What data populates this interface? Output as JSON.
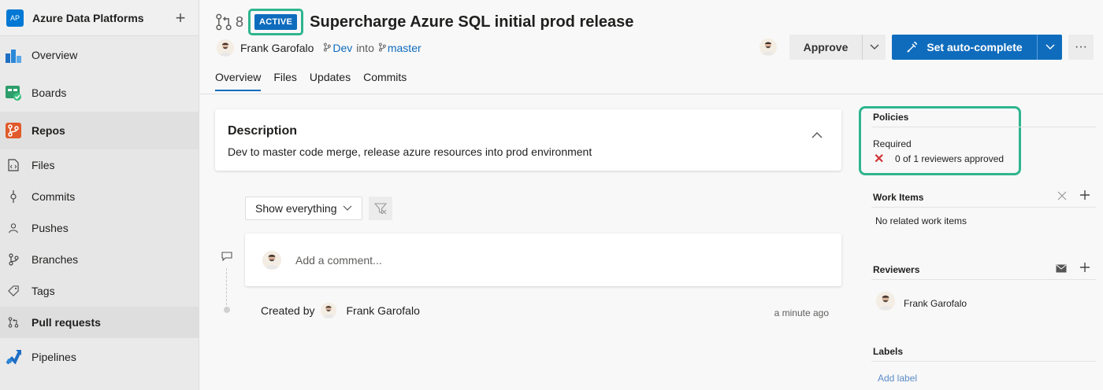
{
  "sidebar": {
    "org_initials": "AP",
    "org_name": "Azure Data Platforms",
    "top_items": [
      {
        "label": "Overview",
        "icon": "overview-icon"
      },
      {
        "label": "Boards",
        "icon": "boards-icon"
      },
      {
        "label": "Repos",
        "icon": "repos-icon"
      }
    ],
    "repo_items": [
      {
        "label": "Files",
        "icon": "file-code-icon"
      },
      {
        "label": "Commits",
        "icon": "commit-icon"
      },
      {
        "label": "Pushes",
        "icon": "push-icon"
      },
      {
        "label": "Branches",
        "icon": "branch-icon"
      },
      {
        "label": "Tags",
        "icon": "tag-icon"
      },
      {
        "label": "Pull requests",
        "icon": "pull-request-icon"
      }
    ],
    "bottom_items": [
      {
        "label": "Pipelines",
        "icon": "pipelines-icon"
      }
    ]
  },
  "pr": {
    "number": "8",
    "status": "ACTIVE",
    "title": "Supercharge Azure SQL initial prod release",
    "author": "Frank Garofalo",
    "source_branch": "Dev",
    "into_text": "into",
    "target_branch": "master"
  },
  "tabs": [
    "Overview",
    "Files",
    "Updates",
    "Commits"
  ],
  "actions": {
    "approve_label": "Approve",
    "autocomplete_label": "Set auto-complete",
    "more_label": "···"
  },
  "description": {
    "title": "Description",
    "text": "Dev to master code merge, release azure resources into prod environment"
  },
  "filter": {
    "selected": "Show everything"
  },
  "comment": {
    "placeholder": "Add a comment..."
  },
  "activity": {
    "created_by_label": "Created by",
    "created_by_name": "Frank Garofalo",
    "time": "a minute ago"
  },
  "policies": {
    "title": "Policies",
    "required_label": "Required",
    "status_text": "0 of 1 reviewers approved"
  },
  "work_items": {
    "title": "Work Items",
    "empty_text": "No related work items"
  },
  "reviewers": {
    "title": "Reviewers",
    "names": [
      "Frank Garofalo"
    ]
  },
  "labels": {
    "title": "Labels",
    "add_label": "Add label"
  },
  "colors": {
    "accent": "#0f6cbd",
    "highlight_outline": "#2fb58f",
    "reject": "#d13438"
  }
}
